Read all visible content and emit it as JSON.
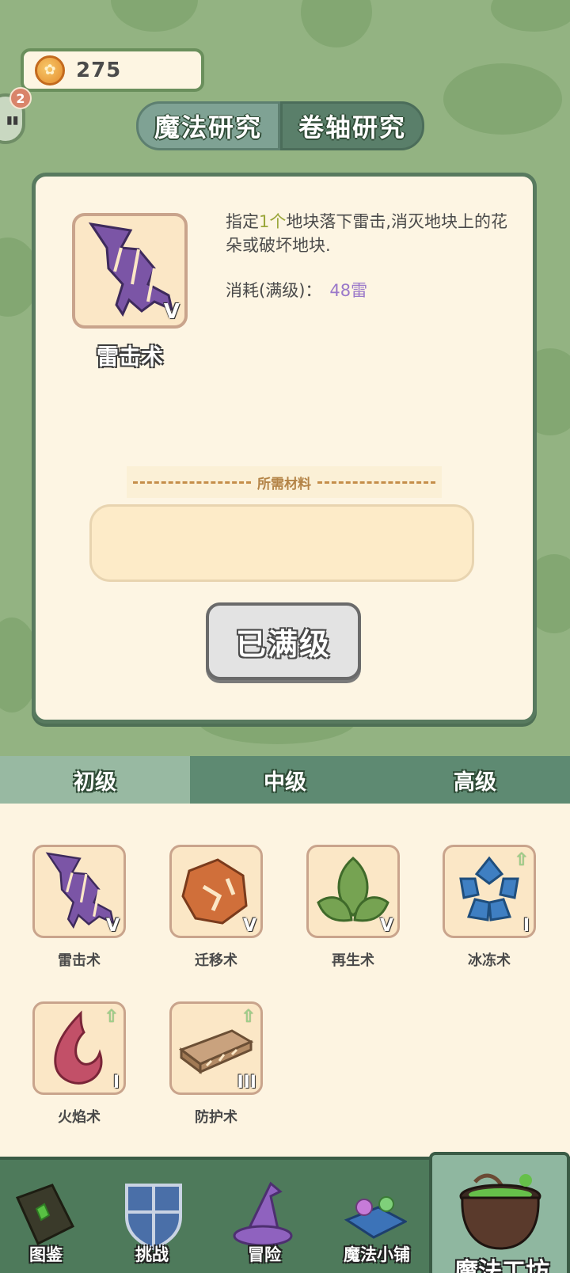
{
  "currency": {
    "icon": "wheat-coin-icon",
    "value": "275"
  },
  "notification": {
    "count": "2"
  },
  "research_tabs": [
    {
      "label": "魔法研究",
      "active": true
    },
    {
      "label": "卷轴研究",
      "active": false
    }
  ],
  "selected_spell": {
    "name": "雷击术",
    "level": "V",
    "icon": "lightning-icon",
    "description_prefix": "指定",
    "description_highlight": "1个",
    "description_suffix": "地块落下雷击,消灭地块上的花朵或破坏地块.",
    "cost_label": "消耗(满级)：",
    "cost_value": "48雷"
  },
  "materials": {
    "title": "所需材料"
  },
  "action_button": {
    "label": "已满级"
  },
  "level_tabs": [
    {
      "label": "初级",
      "active": true
    },
    {
      "label": "中级",
      "active": false
    },
    {
      "label": "高级",
      "active": false
    }
  ],
  "spells": [
    {
      "name": "雷击术",
      "level": "V",
      "icon": "lightning-icon",
      "upgradable": false
    },
    {
      "name": "迁移术",
      "level": "V",
      "icon": "rock-icon",
      "upgradable": false
    },
    {
      "name": "再生术",
      "level": "V",
      "icon": "leaves-icon",
      "upgradable": false
    },
    {
      "name": "冰冻术",
      "level": "I",
      "icon": "snowflake-icon",
      "upgradable": true
    },
    {
      "name": "火焰术",
      "level": "I",
      "icon": "flame-icon",
      "upgradable": true
    },
    {
      "name": "防护术",
      "level": "III",
      "icon": "wood-plank-icon",
      "upgradable": true
    }
  ],
  "bottom_nav": [
    {
      "label": "图鉴",
      "icon": "book-icon",
      "active": false
    },
    {
      "label": "挑战",
      "icon": "shield-icon",
      "active": false
    },
    {
      "label": "冒险",
      "icon": "wizard-hat-icon",
      "active": false
    },
    {
      "label": "魔法小铺",
      "icon": "potion-shop-icon",
      "active": false
    },
    {
      "label": "魔法工坊",
      "icon": "cauldron-icon",
      "active": true
    }
  ],
  "colors": {
    "background_green": "#93b382",
    "card_cream": "#fdf5e3",
    "accent_purple": "#9a78c9",
    "highlight_olive": "#9aa63a",
    "nav_green": "#4e7a5b"
  }
}
